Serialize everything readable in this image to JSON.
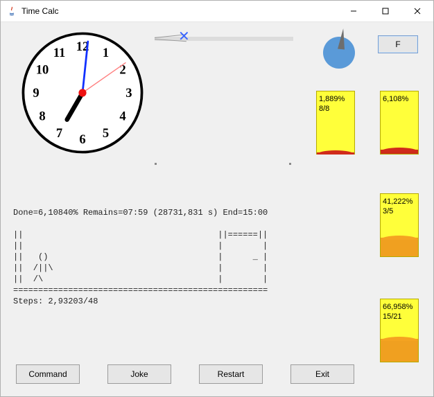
{
  "window": {
    "title": "Time Calc"
  },
  "winControls": {
    "minimize": "min",
    "maximize": "max",
    "close": "close"
  },
  "topRightButton": {
    "label": "F"
  },
  "clock": {
    "numerals": [
      "12",
      "1",
      "2",
      "3",
      "4",
      "5",
      "6",
      "7",
      "8",
      "9",
      "10",
      "11"
    ],
    "hourAngleDeg": 210,
    "minuteAngleDeg": 6,
    "secondAngleDeg": 55
  },
  "pie": {
    "fractionDone": 0.061
  },
  "progress": {
    "box1": {
      "percentText": "1,889%",
      "countText": "8/8",
      "fillPct": 2,
      "fillColor": "red"
    },
    "box2": {
      "percentText": "6,108%",
      "countText": "",
      "fillPct": 7,
      "fillColor": "red"
    },
    "box3": {
      "percentText": "41,222%",
      "countText": "3/5",
      "fillPct": 30,
      "fillColor": "orange"
    },
    "box4": {
      "percentText": "66,958%",
      "countText": "15/21",
      "fillPct": 37,
      "fillColor": "orange"
    }
  },
  "statusLine": "Done=6,10840% Remains=07:59 (28731,831 s) End=15:00",
  "ascii": "||                                       ||======||\n||                                       |        |\n||   ()                                  |      _ |\n||  /||\\                                 |        |\n||  /\\                                   |        |\n===================================================",
  "stepsLine": "Steps: 2,93203/48",
  "buttons": {
    "command": "Command",
    "joke": "Joke",
    "restart": "Restart",
    "exit": "Exit"
  }
}
